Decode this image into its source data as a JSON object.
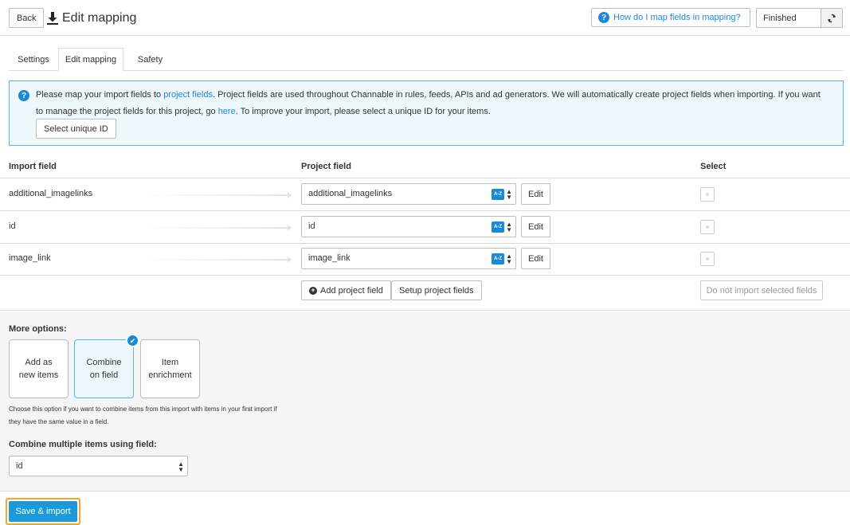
{
  "header": {
    "back_label": "Back",
    "title": "Edit mapping",
    "help_link": "How do I map fields in mapping?",
    "status_value": "Finished"
  },
  "tabs": [
    {
      "label": "Settings",
      "active": false
    },
    {
      "label": "Edit mapping",
      "active": true
    },
    {
      "label": "Safety",
      "active": false
    }
  ],
  "info": {
    "text_1": "Please map your import fields to ",
    "link_1": "project fields",
    "text_2": ". Project fields are used throughout Channable in rules, feeds, APIs and ad generators. We will automatically create project fields when importing. If you want to manage the project fields for this project, go ",
    "link_2": "here",
    "text_3": ". To improve your import, please select a unique ID for your items.",
    "button": "Select unique ID"
  },
  "table": {
    "headers": {
      "import": "Import field",
      "project": "Project field",
      "select": "Select"
    },
    "rows": [
      {
        "import_field": "additional_imagelinks",
        "project_field": "additional_imagelinks"
      },
      {
        "import_field": "id",
        "project_field": "id"
      },
      {
        "import_field": "image_link",
        "project_field": "image_link"
      }
    ],
    "edit_label": "Edit",
    "az_label": "A-Z"
  },
  "actions": {
    "add_project_field": "Add project field",
    "setup_project_fields": "Setup project fields",
    "do_not_import": "Do not import selected fields"
  },
  "more_options": {
    "title": "More options:",
    "options": [
      {
        "line1": "Add as",
        "line2": "new items",
        "selected": false
      },
      {
        "line1": "Combine",
        "line2": "on field",
        "selected": true
      },
      {
        "line1": "Item",
        "line2": "enrichment",
        "selected": false
      }
    ],
    "description": "Choose this option if you want to combine items from this import with items in your first import if they have the same value in a field.",
    "combine_label": "Combine multiple items using field:",
    "combine_value": "id"
  },
  "footer": {
    "save_label": "Save & import"
  },
  "colors": {
    "accent": "#1a8ad8",
    "info_bg": "#eef7fc",
    "highlight": "#f5a623"
  }
}
